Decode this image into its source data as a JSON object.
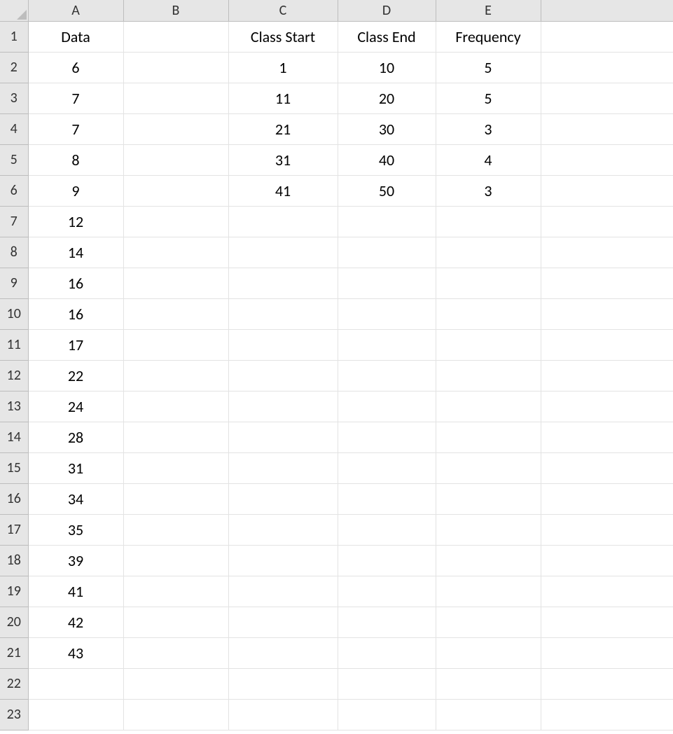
{
  "columns": [
    "A",
    "B",
    "C",
    "D",
    "E",
    ""
  ],
  "rows": [
    "1",
    "2",
    "3",
    "4",
    "5",
    "6",
    "7",
    "8",
    "9",
    "10",
    "11",
    "12",
    "13",
    "14",
    "15",
    "16",
    "17",
    "18",
    "19",
    "20",
    "21",
    "22",
    "23"
  ],
  "grid": {
    "r1": {
      "A": "Data",
      "B": "",
      "C": "Class Start",
      "D": "Class End",
      "E": "Frequency",
      "F": ""
    },
    "r2": {
      "A": "6",
      "B": "",
      "C": "1",
      "D": "10",
      "E": "5",
      "F": ""
    },
    "r3": {
      "A": "7",
      "B": "",
      "C": "11",
      "D": "20",
      "E": "5",
      "F": ""
    },
    "r4": {
      "A": "7",
      "B": "",
      "C": "21",
      "D": "30",
      "E": "3",
      "F": ""
    },
    "r5": {
      "A": "8",
      "B": "",
      "C": "31",
      "D": "40",
      "E": "4",
      "F": ""
    },
    "r6": {
      "A": "9",
      "B": "",
      "C": "41",
      "D": "50",
      "E": "3",
      "F": ""
    },
    "r7": {
      "A": "12",
      "B": "",
      "C": "",
      "D": "",
      "E": "",
      "F": ""
    },
    "r8": {
      "A": "14",
      "B": "",
      "C": "",
      "D": "",
      "E": "",
      "F": ""
    },
    "r9": {
      "A": "16",
      "B": "",
      "C": "",
      "D": "",
      "E": "",
      "F": ""
    },
    "r10": {
      "A": "16",
      "B": "",
      "C": "",
      "D": "",
      "E": "",
      "F": ""
    },
    "r11": {
      "A": "17",
      "B": "",
      "C": "",
      "D": "",
      "E": "",
      "F": ""
    },
    "r12": {
      "A": "22",
      "B": "",
      "C": "",
      "D": "",
      "E": "",
      "F": ""
    },
    "r13": {
      "A": "24",
      "B": "",
      "C": "",
      "D": "",
      "E": "",
      "F": ""
    },
    "r14": {
      "A": "28",
      "B": "",
      "C": "",
      "D": "",
      "E": "",
      "F": ""
    },
    "r15": {
      "A": "31",
      "B": "",
      "C": "",
      "D": "",
      "E": "",
      "F": ""
    },
    "r16": {
      "A": "34",
      "B": "",
      "C": "",
      "D": "",
      "E": "",
      "F": ""
    },
    "r17": {
      "A": "35",
      "B": "",
      "C": "",
      "D": "",
      "E": "",
      "F": ""
    },
    "r18": {
      "A": "39",
      "B": "",
      "C": "",
      "D": "",
      "E": "",
      "F": ""
    },
    "r19": {
      "A": "41",
      "B": "",
      "C": "",
      "D": "",
      "E": "",
      "F": ""
    },
    "r20": {
      "A": "42",
      "B": "",
      "C": "",
      "D": "",
      "E": "",
      "F": ""
    },
    "r21": {
      "A": "43",
      "B": "",
      "C": "",
      "D": "",
      "E": "",
      "F": ""
    },
    "r22": {
      "A": "",
      "B": "",
      "C": "",
      "D": "",
      "E": "",
      "F": ""
    },
    "r23": {
      "A": "",
      "B": "",
      "C": "",
      "D": "",
      "E": "",
      "F": ""
    }
  }
}
